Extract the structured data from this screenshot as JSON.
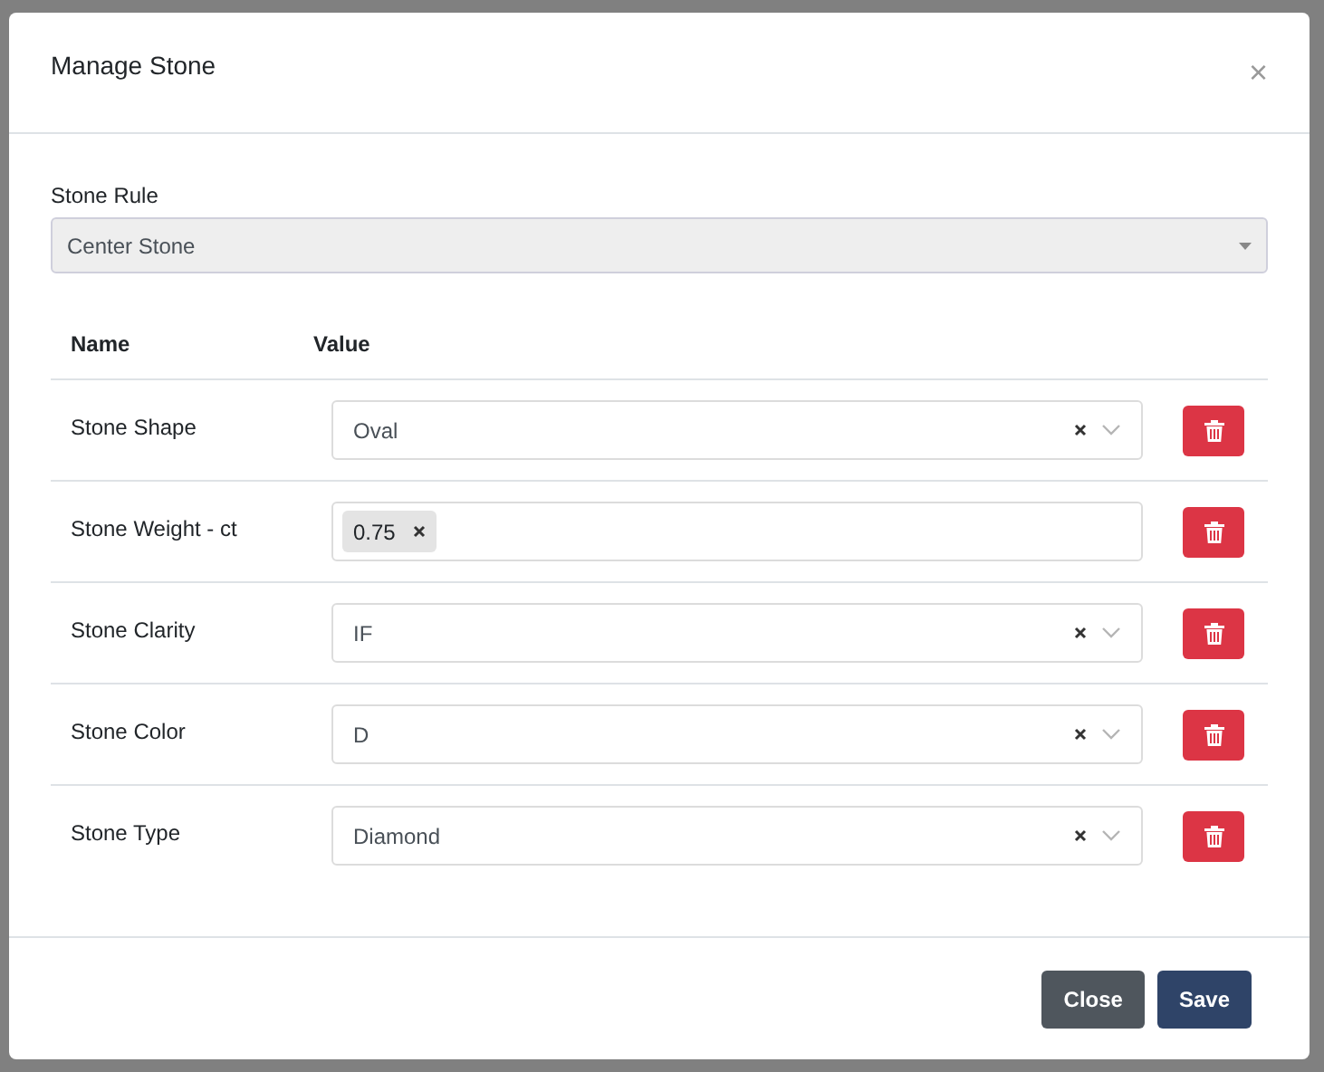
{
  "modal": {
    "title": "Manage Stone",
    "close_icon": "×"
  },
  "stone_rule": {
    "label": "Stone Rule",
    "value": "Center Stone"
  },
  "table": {
    "columns": [
      "Name",
      "Value"
    ],
    "rows": [
      {
        "name": "Stone Shape",
        "kind": "select",
        "value": "Oval"
      },
      {
        "name": "Stone Weight - ct",
        "kind": "tags",
        "tags": [
          "0.75"
        ]
      },
      {
        "name": "Stone Clarity",
        "kind": "select",
        "value": "IF"
      },
      {
        "name": "Stone Color",
        "kind": "select",
        "value": "D"
      },
      {
        "name": "Stone Type",
        "kind": "select",
        "value": "Diamond"
      }
    ]
  },
  "buttons": [
    "Close",
    "Save"
  ]
}
